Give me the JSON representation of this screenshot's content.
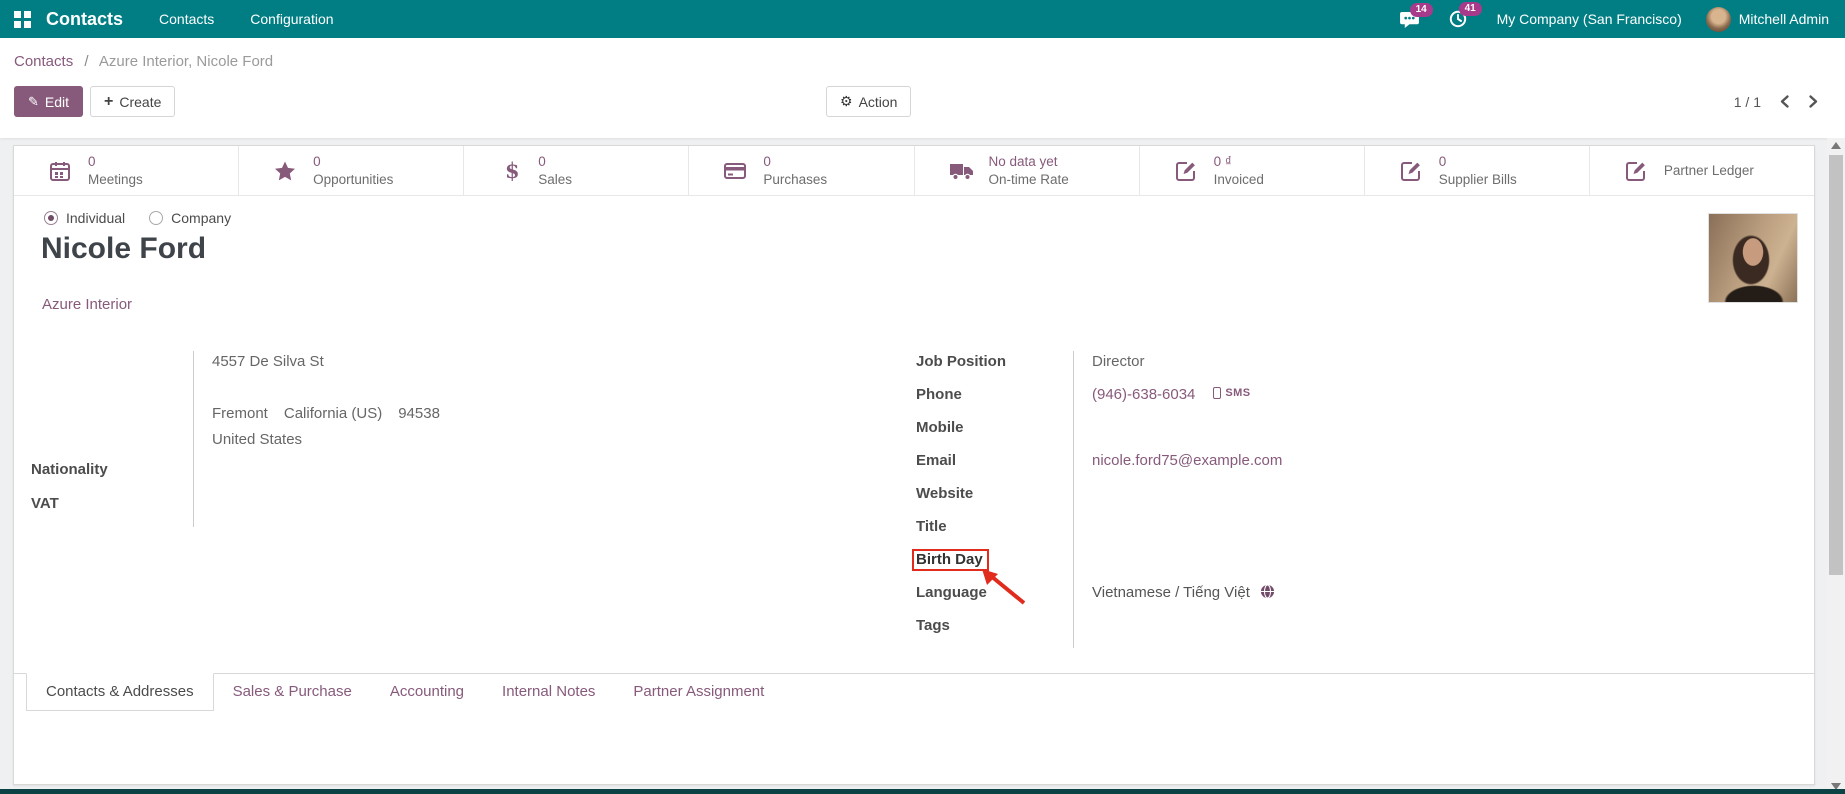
{
  "colors": {
    "navbar": "#017e84",
    "primary": "#875A7B",
    "badge": "#a73a8a",
    "annotation_red": "#e02b1d"
  },
  "navbar": {
    "app_name": "Contacts",
    "menus": [
      {
        "label": "Contacts"
      },
      {
        "label": "Configuration"
      }
    ],
    "messages_badge": "14",
    "activities_badge": "41",
    "company": "My Company (San Francisco)",
    "user": "Mitchell Admin"
  },
  "control_panel": {
    "breadcrumb": {
      "parent": "Contacts",
      "separator": "/",
      "current": "Azure Interior, Nicole Ford"
    },
    "buttons": {
      "edit": "Edit",
      "create": "Create",
      "action": "Action"
    },
    "pager": {
      "value": "1 / 1"
    }
  },
  "stat_buttons": [
    {
      "icon": "calendar-icon",
      "value": "0",
      "label": "Meetings"
    },
    {
      "icon": "star-icon",
      "value": "0",
      "label": "Opportunities"
    },
    {
      "icon": "dollar-icon",
      "value": "0",
      "label": "Sales"
    },
    {
      "icon": "credit-card-icon",
      "value": "0",
      "label": "Purchases"
    },
    {
      "icon": "truck-icon",
      "value": "No data yet",
      "label": "On-time Rate"
    },
    {
      "icon": "edit-note-icon",
      "value": "0 ₫",
      "label": "Invoiced"
    },
    {
      "icon": "edit-note-icon",
      "value": "0",
      "label": "Supplier Bills"
    },
    {
      "icon": "edit-note-icon",
      "value": "",
      "label": "Partner Ledger"
    }
  ],
  "record": {
    "type_options": {
      "individual": "Individual",
      "company": "Company",
      "selected": "Individual"
    },
    "name": "Nicole Ford",
    "company_link": "Azure Interior",
    "address": {
      "street": "4557 De Silva St",
      "city": "Fremont",
      "state": "California (US)",
      "zip": "94538",
      "country": "United States"
    },
    "left_fields": [
      {
        "label": "Nationality",
        "value": ""
      },
      {
        "label": "VAT",
        "value": ""
      }
    ],
    "right_fields": [
      {
        "label": "Job Position",
        "value": "Director"
      },
      {
        "label": "Phone",
        "value": "(946)-638-6034",
        "extra": "SMS"
      },
      {
        "label": "Mobile",
        "value": ""
      },
      {
        "label": "Email",
        "value": "nicole.ford75@example.com"
      },
      {
        "label": "Website",
        "value": ""
      },
      {
        "label": "Title",
        "value": ""
      },
      {
        "label": "Birth Day",
        "value": "",
        "highlighted": true
      },
      {
        "label": "Language",
        "value": "Vietnamese / Tiếng Việt"
      },
      {
        "label": "Tags",
        "value": ""
      }
    ]
  },
  "tabs": [
    {
      "label": "Contacts & Addresses",
      "active": true
    },
    {
      "label": "Sales & Purchase",
      "active": false
    },
    {
      "label": "Accounting",
      "active": false
    },
    {
      "label": "Internal Notes",
      "active": false
    },
    {
      "label": "Partner Assignment",
      "active": false
    }
  ]
}
